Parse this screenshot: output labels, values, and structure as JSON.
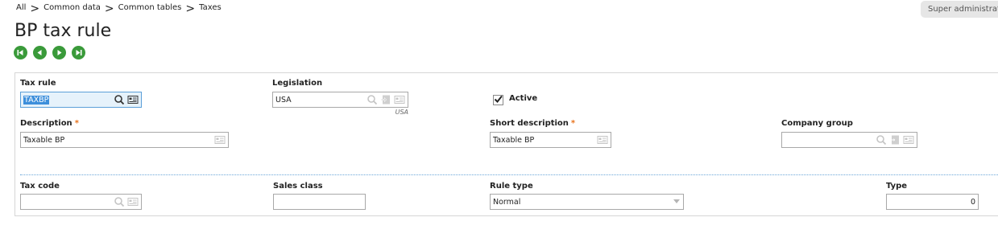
{
  "breadcrumb": {
    "items": [
      "All",
      "Common data",
      "Common tables",
      "Taxes"
    ],
    "separator": ">"
  },
  "user": {
    "label": "Super administrator",
    "icon": "key-icon"
  },
  "page": {
    "title": "BP tax rule"
  },
  "navigation": {
    "icons": [
      "first-record-icon",
      "previous-record-icon",
      "next-record-icon",
      "last-record-icon"
    ],
    "color": "#3a9a3a"
  },
  "form": {
    "tax_rule": {
      "label": "Tax rule",
      "value": "TAXBP"
    },
    "legislation": {
      "label": "Legislation",
      "value": "USA",
      "subtext": "USA"
    },
    "active": {
      "label": "Active",
      "checked": true
    },
    "description": {
      "label": "Description",
      "value": "Taxable BP",
      "required_mark": "*"
    },
    "short_description": {
      "label": "Short description",
      "value": "Taxable BP",
      "required_mark": "*"
    },
    "company_group": {
      "label": "Company group",
      "value": ""
    },
    "tax_code": {
      "label": "Tax code",
      "value": ""
    },
    "sales_class": {
      "label": "Sales class",
      "value": ""
    },
    "rule_type": {
      "label": "Rule type",
      "value": "Normal"
    },
    "type": {
      "label": "Type",
      "value": "0"
    }
  },
  "colors": {
    "accent": "#3d8fdb",
    "required": "#e8731d",
    "separator": "#6aa7d8"
  }
}
